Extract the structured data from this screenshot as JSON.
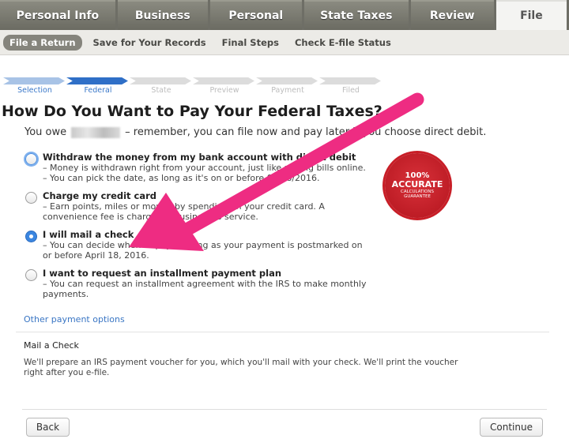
{
  "top_tabs": [
    "Personal Info",
    "Business",
    "Personal",
    "State Taxes",
    "Review",
    "File"
  ],
  "sub_nav": [
    "File a Return",
    "Save for Your Records",
    "Final Steps",
    "Check E-file Status"
  ],
  "progress": [
    "Selection",
    "Federal",
    "State",
    "Preview",
    "Payment",
    "Filed"
  ],
  "page_title": "How Do You Want to Pay Your Federal Taxes?",
  "owe": {
    "prefix": "You owe",
    "suffix": "– remember, you can file now and pay later if you choose direct debit."
  },
  "options": [
    {
      "title": "Withdraw the money from my bank account with direct debit",
      "details": [
        "– Money is withdrawn right from your account, just like paying bills online.",
        "– You can pick the date, as long as it's on or before 04/18/2016."
      ]
    },
    {
      "title": "Charge my credit card",
      "details": [
        "– Earn points, miles or money by spending on your credit card. A convenience fee is charged for using this service."
      ]
    },
    {
      "title": "I will mail a check",
      "details": [
        "– You can decide when to pay, as long as your payment is postmarked on or before April 18, 2016."
      ]
    },
    {
      "title": "I want to request an installment payment plan",
      "details": [
        "– You can request an installment agreement with the IRS to make monthly payments."
      ]
    }
  ],
  "other_payment_link": "Other payment options",
  "mail_check": {
    "title": "Mail a Check",
    "text": "We'll prepare an IRS payment voucher for you, which you'll mail with your check. We'll print the voucher right after you e-file."
  },
  "badge": {
    "line1": "100%",
    "line2": "ACCURATE",
    "line3": "CALCULATIONS",
    "line4": "GUARANTEE"
  },
  "buttons": {
    "back": "Back",
    "continue": "Continue"
  },
  "colors": {
    "arrow": "#ee2c82",
    "link": "#3a76c4",
    "badge": "#c81e27"
  }
}
